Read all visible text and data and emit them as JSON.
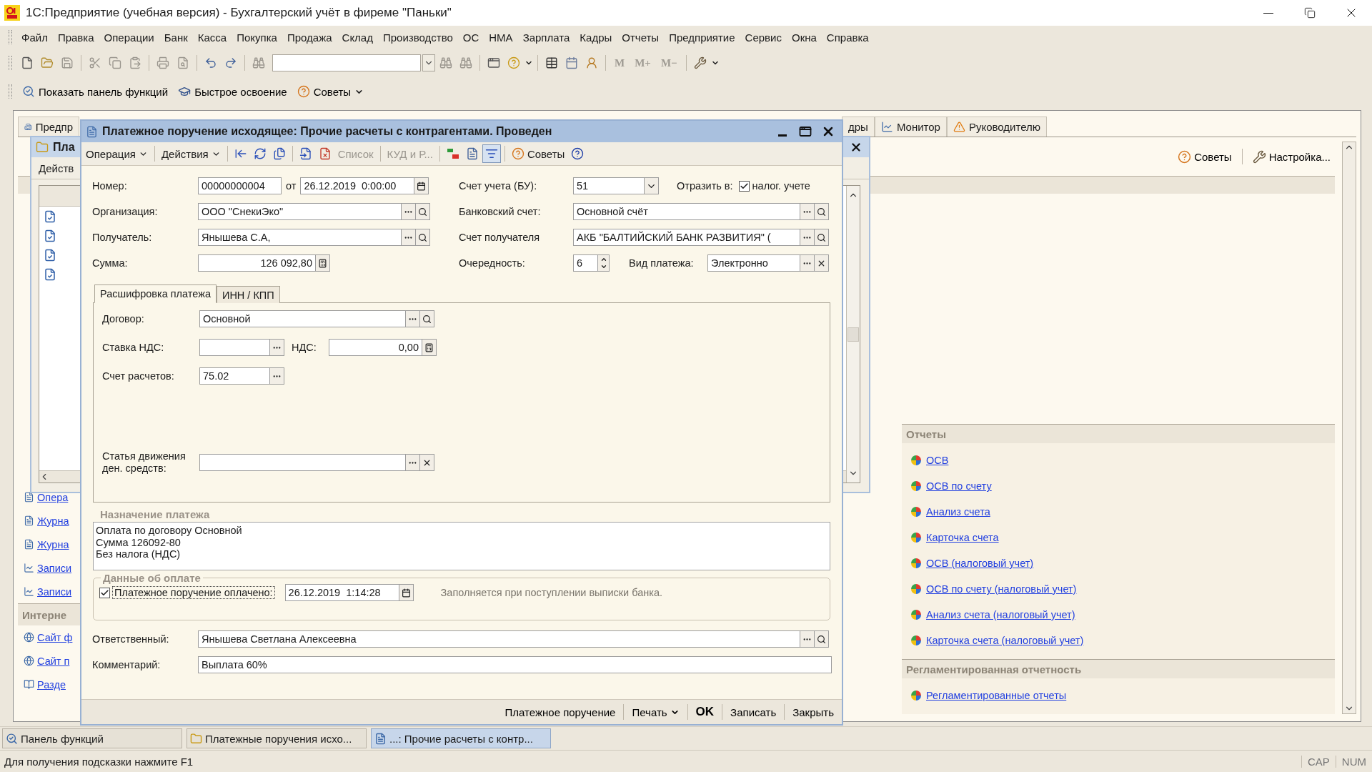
{
  "window": {
    "title": "1С:Предприятие (учебная версия) - Бухгалтерский учёт в фиреме \"Паньки\""
  },
  "menu": [
    "Файл",
    "Правка",
    "Операции",
    "Банк",
    "Касса",
    "Покупка",
    "Продажа",
    "Склад",
    "Производство",
    "ОС",
    "НМА",
    "Зарплата",
    "Кадры",
    "Отчеты",
    "Предприятие",
    "Сервис",
    "Окна",
    "Справка"
  ],
  "toolbar": {
    "memory_buttons": [
      {
        "label": "M",
        "disabled": true
      },
      {
        "label": "M+",
        "disabled": true
      },
      {
        "label": "M−",
        "disabled": true
      }
    ]
  },
  "quick_bar": [
    {
      "label": "Показать панель функций",
      "dropdown": false
    },
    {
      "label": "Быстрое освоение",
      "dropdown": false
    },
    {
      "label": "Советы",
      "dropdown": true
    }
  ],
  "function_panel": {
    "tabs": [
      {
        "label": "Предпр",
        "selected": false
      },
      {
        "label": "дры",
        "selected": false
      },
      {
        "label": "Монитор",
        "selected": false
      },
      {
        "label": "Руководителю",
        "selected": false
      }
    ],
    "actions": [
      "Советы",
      "Настройка..."
    ],
    "left_items": [
      {
        "kind": "link",
        "label": "Опера"
      },
      {
        "kind": "link",
        "label": "Журна"
      },
      {
        "kind": "link",
        "label": "Журна"
      },
      {
        "kind": "link",
        "label": "Записи"
      },
      {
        "kind": "link",
        "label": "Записи"
      },
      {
        "kind": "header",
        "label": "Интерне"
      },
      {
        "kind": "link",
        "label": "Сайт ф"
      },
      {
        "kind": "link",
        "label": "Сайт п"
      },
      {
        "kind": "link",
        "label": "Разде"
      }
    ],
    "sections": [
      {
        "title": "Отчеты",
        "links": [
          "ОСВ",
          "ОСВ по счету",
          "Анализ счета",
          "Карточка счета",
          "ОСВ (налоговый учет)",
          "ОСВ по счету (налоговый учет)",
          "Анализ счета (налоговый учет)",
          "Карточка счета (налоговый учет)"
        ]
      },
      {
        "title": "Регламентированная отчетность",
        "links": [
          "Регламентированные отчеты"
        ]
      }
    ]
  },
  "list_window": {
    "title": "Пла",
    "actions_menu": "Действ",
    "rows": [
      {
        "posted": true
      },
      {
        "posted": true
      },
      {
        "posted": true
      },
      {
        "posted": true
      }
    ]
  },
  "dialog": {
    "title": "Платежное поручение исходящее: Прочие расчеты с контрагентами. Проведен",
    "toolbar": [
      {
        "label": "Операция",
        "kind": "menu",
        "disabled": false
      },
      {
        "label": "Действия",
        "kind": "menu",
        "disabled": false
      },
      {
        "label": "Список",
        "kind": "plain",
        "disabled": true
      },
      {
        "label": "КУД и Р...",
        "kind": "plain",
        "disabled": true
      },
      {
        "label": "Советы",
        "kind": "tips",
        "disabled": false
      }
    ],
    "toggle_pressed": true,
    "number": {
      "label": "Номер:",
      "value": "00000000004"
    },
    "date_prefix": "от",
    "date": "26.12.2019  0:00:00",
    "account": {
      "label": "Счет учета (БУ):",
      "value": "51"
    },
    "reflect": {
      "label": "Отразить в:",
      "checkbox_label": "налог. учете",
      "checked": true
    },
    "organization": {
      "label": "Организация:",
      "value": "ООО \"СнекиЭко\""
    },
    "bank_account": {
      "label": "Банковский счет:",
      "value": "Основной счёт"
    },
    "recipient": {
      "label": "Получатель:",
      "value": "Янышева С.А,"
    },
    "recipient_account": {
      "label": "Счет получателя",
      "value": "АКБ \"БАЛТИЙСКИЙ БАНК РАЗВИТИЯ\" ("
    },
    "sum": {
      "label": "Сумма:",
      "value": "126 092,80"
    },
    "priority": {
      "label": "Очередность:",
      "value": "6"
    },
    "payment_type": {
      "label": "Вид платежа:",
      "value": "Электронно"
    },
    "tabs": [
      {
        "label": "Расшифровка платежа",
        "selected": true
      },
      {
        "label": "ИНН / КПП",
        "selected": false
      }
    ],
    "contract": {
      "label": "Договор:",
      "value": "Основной"
    },
    "vat_rate": {
      "label": "Ставка НДС:"
    },
    "vat": {
      "label": "НДС:",
      "value": "0,00"
    },
    "settlement_account": {
      "label": "Счет расчетов:",
      "value": "75.02"
    },
    "cash_flow": {
      "label": "Статья движения ден. средств:"
    },
    "purpose": {
      "title": "Назначение платежа",
      "lines": [
        "Оплата по договору Основной",
        "Сумма 126092-80",
        "Без налога (НДС)"
      ]
    },
    "payment": {
      "title": "Данные об оплате",
      "checkbox_label": "Платежное поручение оплачено:",
      "checked": true,
      "date": "26.12.2019  1:14:28",
      "hint": "Заполняется при поступлении выписки банка."
    },
    "responsible": {
      "label": "Ответственный:",
      "value": "Янышева Светлана Алексеевна"
    },
    "comment": {
      "label": "Комментарий:",
      "value": "Выплата 60%"
    },
    "buttons": [
      {
        "label": "Платежное поручение",
        "kind": "plain"
      },
      {
        "label": "Печать",
        "kind": "menu"
      },
      {
        "label": "OK",
        "kind": "default"
      },
      {
        "label": "Записать",
        "kind": "plain"
      },
      {
        "label": "Закрыть",
        "kind": "plain"
      }
    ]
  },
  "taskbar": [
    {
      "label": "Панель функций",
      "selected": false
    },
    {
      "label": "Платежные поручения исхо...",
      "selected": false
    },
    {
      "label": "...: Прочие расчеты с контр...",
      "selected": true
    }
  ],
  "status": {
    "hint": "Для получения подсказки нажмите F1",
    "indicators": [
      "CAP",
      "NUM"
    ]
  }
}
